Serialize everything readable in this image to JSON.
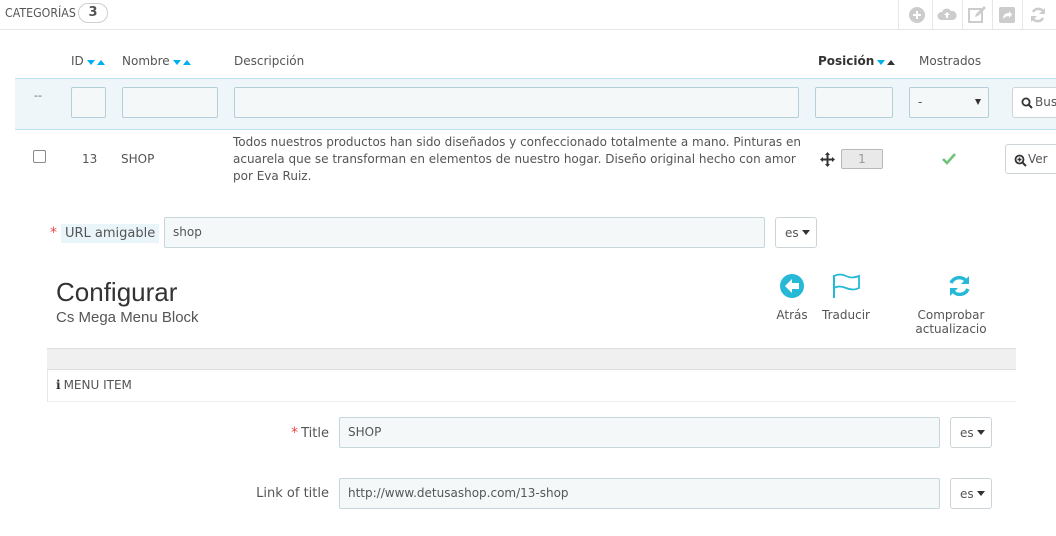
{
  "panel": {
    "title": "CATEGORÍAS",
    "count": "3"
  },
  "toolbar": {
    "icons": [
      "add-icon",
      "cloud-upload-icon",
      "edit-icon",
      "export-icon",
      "refresh-icon"
    ],
    "icon_color": "#cccccc"
  },
  "table": {
    "headers": {
      "id": "ID",
      "name": "Nombre",
      "description": "Descripción",
      "position": "Posición",
      "shown": "Mostrados"
    },
    "filter": {
      "dash": "--",
      "shown_select": "-",
      "search_label": "Bus"
    },
    "rows": [
      {
        "id": "13",
        "name": "SHOP",
        "description": "Todos nuestros productos han sido diseñados  y confeccionado totalmente a mano. Pinturas en acuarela que se transforman en elementos de nuestro hogar. Diseño original hecho con amor por Eva Ruiz.",
        "position": "1",
        "shown": true,
        "view_label": "Ver"
      }
    ]
  },
  "url_field": {
    "required_mark": "*",
    "label": "URL amigable",
    "value": "shop",
    "lang": "es"
  },
  "configure": {
    "title": "Configurar",
    "subtitle": "Cs Mega Menu Block",
    "actions": [
      {
        "label": "Atrás",
        "icon": "back-arrow-icon"
      },
      {
        "label": "Traducir",
        "icon": "flag-icon"
      },
      {
        "label": "Comprobar actualizacio",
        "icon": "refresh-icon"
      }
    ]
  },
  "menu_panel": {
    "title": "MENU ITEM",
    "fields": [
      {
        "required_mark": "*",
        "label": "Title",
        "value": "SHOP",
        "lang": "es"
      },
      {
        "label": "Link of title",
        "value": "http://www.detusashop.com/13-shop",
        "lang": "es"
      }
    ]
  },
  "colors": {
    "accent": "#00aff0",
    "check": "#72c279",
    "action_icon": "#25b9d7",
    "required": "#e44444"
  }
}
